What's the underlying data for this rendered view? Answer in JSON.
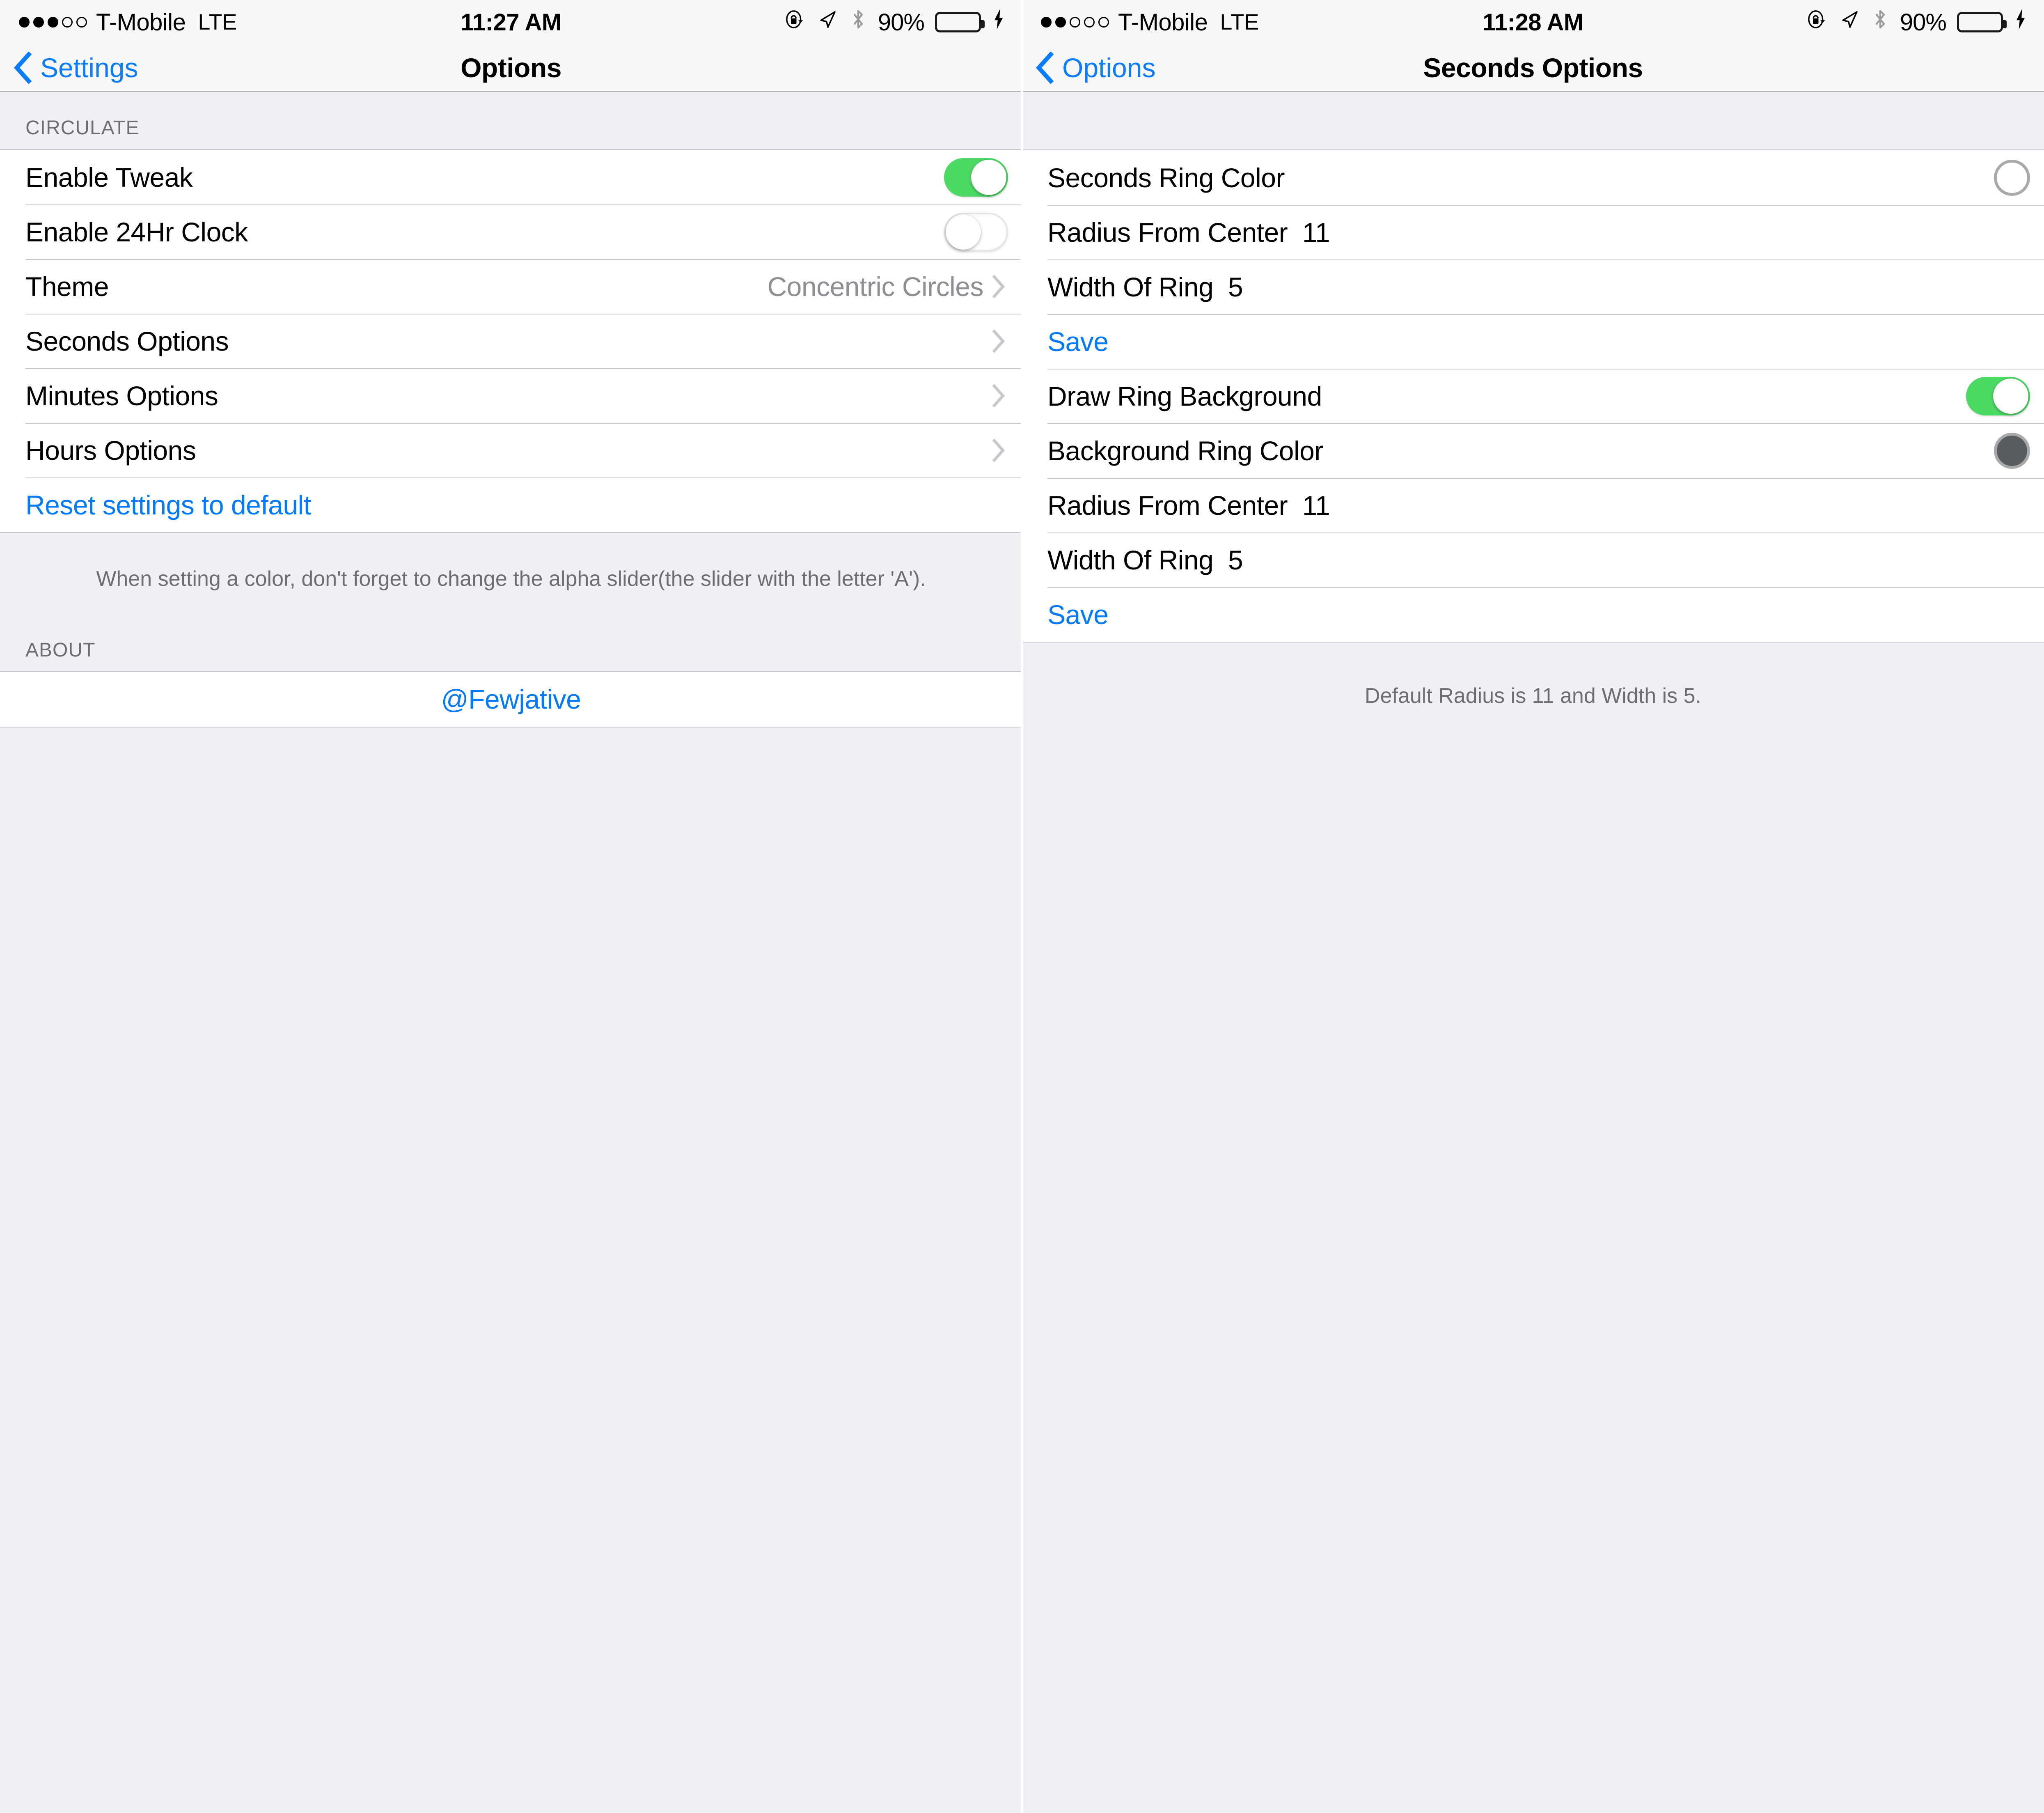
{
  "left": {
    "status_bar": {
      "signal_filled": 3,
      "signal_empty": 2,
      "carrier": "T-Mobile",
      "network": "LTE",
      "time": "11:27 AM",
      "battery_percent": "90%",
      "battery_level": 90,
      "icons": [
        "rotation-lock-icon",
        "location-arrow-icon",
        "bluetooth-icon",
        "lightning-bolt-icon"
      ]
    },
    "nav": {
      "back_label": "Settings",
      "title": "Options"
    },
    "section_header": "CIRCULATE",
    "rows": [
      {
        "label": "Enable Tweak",
        "type": "switch",
        "value": "on"
      },
      {
        "label": "Enable 24Hr Clock",
        "type": "switch",
        "value": "off"
      },
      {
        "label": "Theme",
        "type": "disclosure",
        "value": "Concentric Circles"
      },
      {
        "label": "Seconds Options",
        "type": "disclosure",
        "value": ""
      },
      {
        "label": "Minutes Options",
        "type": "disclosure",
        "value": ""
      },
      {
        "label": "Hours Options",
        "type": "disclosure",
        "value": ""
      },
      {
        "label": "Reset settings to default",
        "type": "action",
        "value": ""
      }
    ],
    "footer_note": "When setting a color, don't forget to change the alpha slider(the slider with the letter 'A').",
    "about_header": "ABOUT",
    "about_link": "@Fewjative"
  },
  "right": {
    "status_bar": {
      "signal_filled": 2,
      "signal_empty": 3,
      "carrier": "T-Mobile",
      "network": "LTE",
      "time": "11:28 AM",
      "battery_percent": "90%",
      "battery_level": 90,
      "icons": [
        "rotation-lock-icon",
        "location-arrow-icon",
        "bluetooth-icon",
        "lightning-bolt-icon"
      ]
    },
    "nav": {
      "back_label": "Options",
      "title": "Seconds Options"
    },
    "rows": [
      {
        "label": "Seconds Ring Color",
        "type": "swatch-outline",
        "value": "#ffffff"
      },
      {
        "label": "Radius From Center  11",
        "type": "plain",
        "value": "11"
      },
      {
        "label": "Width Of Ring  5",
        "type": "plain",
        "value": "5"
      },
      {
        "label": "Save",
        "type": "action",
        "value": ""
      },
      {
        "label": "Draw Ring Background",
        "type": "switch",
        "value": "on"
      },
      {
        "label": "Background Ring Color",
        "type": "swatch-filled",
        "value": "#5a5c5e"
      },
      {
        "label": "Radius From Center  11",
        "type": "plain",
        "value": "11"
      },
      {
        "label": "Width Of Ring  5",
        "type": "plain",
        "value": "5"
      },
      {
        "label": "Save",
        "type": "action",
        "value": ""
      }
    ],
    "footer_note": "Default Radius is 11 and Width is 5."
  },
  "colors": {
    "tint_blue": "#007aff",
    "switch_on_green": "#4cd964",
    "group_bg": "#efeff4",
    "separator": "#c8c7cc",
    "secondary_text": "#8e8e93",
    "battery_green": "#4ed964"
  }
}
